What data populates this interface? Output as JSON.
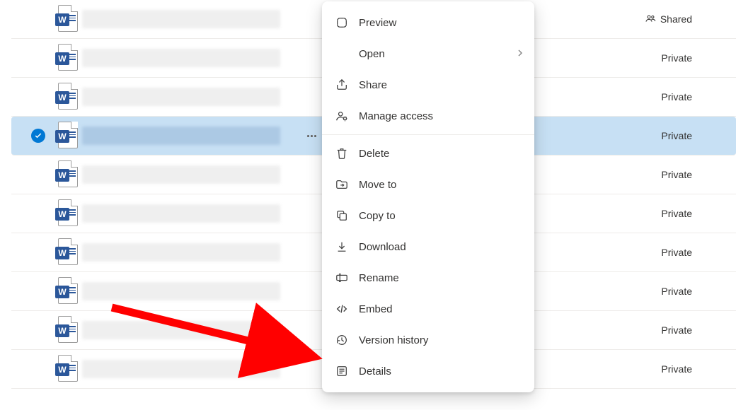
{
  "sharing": {
    "shared_label": "Shared",
    "private_label": "Private"
  },
  "rows": [
    {
      "sharing": "shared"
    },
    {
      "sharing": "private"
    },
    {
      "sharing": "private"
    },
    {
      "sharing": "private",
      "selected": true
    },
    {
      "sharing": "private"
    },
    {
      "sharing": "private"
    },
    {
      "sharing": "private"
    },
    {
      "sharing": "private"
    },
    {
      "sharing": "private"
    },
    {
      "sharing": "private"
    }
  ],
  "menu": {
    "preview": "Preview",
    "open": "Open",
    "share": "Share",
    "manage_access": "Manage access",
    "delete": "Delete",
    "move_to": "Move to",
    "copy_to": "Copy to",
    "download": "Download",
    "rename": "Rename",
    "embed": "Embed",
    "version_history": "Version history",
    "details": "Details"
  }
}
